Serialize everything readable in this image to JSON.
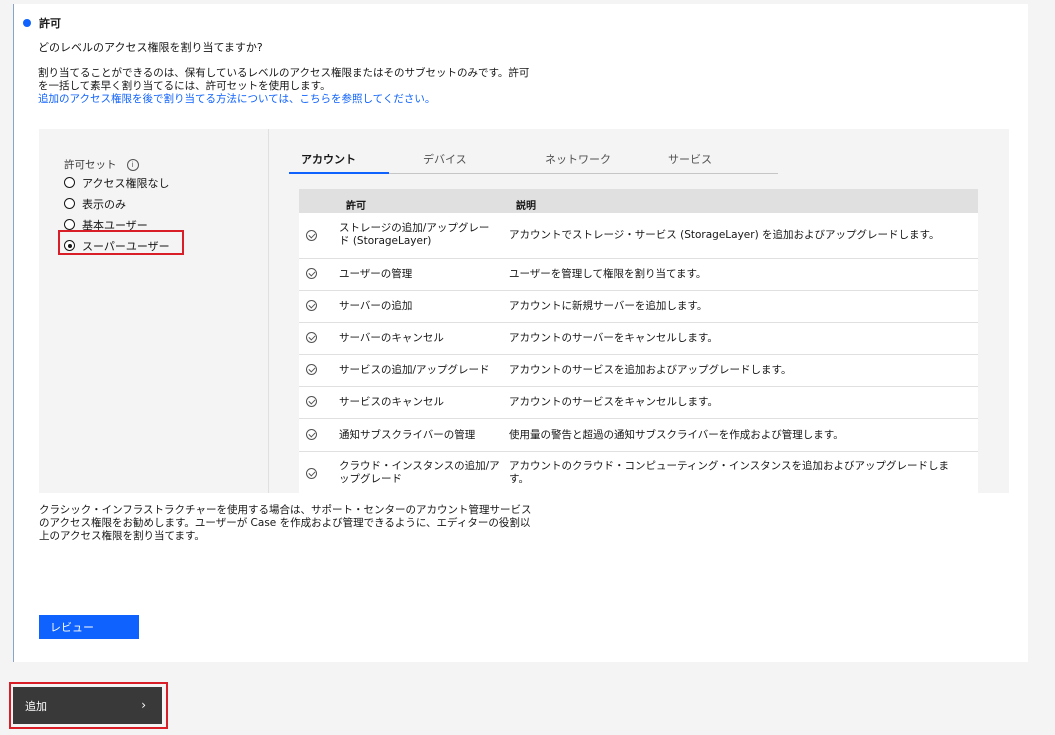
{
  "step": {
    "title": "許可",
    "question": "どのレベルのアクセス権限を割り当てますか?",
    "desc_line1": "割り当てることができるのは、保有しているレベルのアクセス権限またはそのサブセットのみです。許可",
    "desc_line2": "を一括して素早く割り当てるには、許可セットを使用します。",
    "desc_link": "追加のアクセス権限を後で割り当てる方法については、こちらを参照してください。"
  },
  "permission_sets": {
    "title": "許可セット",
    "info_icon": "info-icon",
    "options": [
      {
        "label": "アクセス権限なし",
        "checked": false
      },
      {
        "label": "表示のみ",
        "checked": false
      },
      {
        "label": "基本ユーザー",
        "checked": false
      },
      {
        "label": "スーパーユーザー",
        "checked": true
      }
    ]
  },
  "tabs": [
    "アカウント",
    "デバイス",
    "ネットワーク",
    "サービス"
  ],
  "active_tab": "アカウント",
  "table": {
    "columns": [
      "許可",
      "説明"
    ],
    "rows": [
      {
        "perm": "ストレージの追加/アップグレード (StorageLayer)",
        "desc": "アカウントでストレージ・サービス (StorageLayer) を追加およびアップグレードします。"
      },
      {
        "perm": "ユーザーの管理",
        "desc": "ユーザーを管理して権限を割り当てます。"
      },
      {
        "perm": "サーバーの追加",
        "desc": "アカウントに新規サーバーを追加します。"
      },
      {
        "perm": "サーバーのキャンセル",
        "desc": "アカウントのサーバーをキャンセルします。"
      },
      {
        "perm": "サービスの追加/アップグレード",
        "desc": "アカウントのサービスを追加およびアップグレードします。"
      },
      {
        "perm": "サービスのキャンセル",
        "desc": "アカウントのサービスをキャンセルします。"
      },
      {
        "perm": "通知サブスクライバーの管理",
        "desc": "使用量の警告と超過の通知サブスクライバーを作成および管理します。"
      },
      {
        "perm": "クラウド・インスタンスの追加/アップグレード",
        "desc": "アカウントのクラウド・コンピューティング・インスタンスを追加およびアップグレードしま す。"
      }
    ]
  },
  "note": {
    "line1": "クラシック・インフラストラクチャーを使用する場合は、サポート・センターのアカウント管理サービス",
    "line2": "のアクセス権限をお勧めします。ユーザーが Case を作成および管理できるように、エディターの役割以",
    "line3": "上のアクセス権限を割り当てます。"
  },
  "buttons": {
    "review": "レビュー",
    "add": "追加",
    "add_icon": "chevron-right-icon"
  },
  "colors": {
    "accent": "#0f62fe",
    "highlight": "#da1e28",
    "dark_button": "#393939"
  }
}
